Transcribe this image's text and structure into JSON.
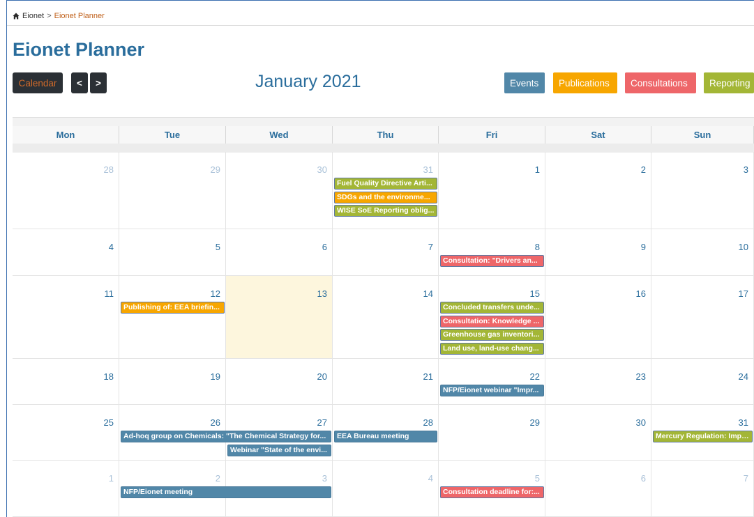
{
  "breadcrumb": {
    "home": "Eionet",
    "separator": ">",
    "current": "Eionet Planner",
    "home_icon": "home-icon"
  },
  "page": {
    "title": "Eionet Planner"
  },
  "toolbar": {
    "calendar_label": "Calendar",
    "prev_label": "<",
    "next_label": ">",
    "month_title": "January 2021"
  },
  "filters": [
    {
      "label": "Events",
      "color": "#5187a8"
    },
    {
      "label": "Publications",
      "color": "#f7a600"
    },
    {
      "label": "Consultations",
      "color": "#ee6669"
    },
    {
      "label": "Reporting",
      "color": "#a3b636"
    }
  ],
  "weekdays": [
    "Mon",
    "Tue",
    "Wed",
    "Thu",
    "Fri",
    "Sat",
    "Sun"
  ],
  "weeks": [
    [
      "28",
      "29",
      "30",
      "31",
      "1",
      "2",
      "3"
    ],
    [
      "4",
      "5",
      "6",
      "7",
      "8",
      "9",
      "10"
    ],
    [
      "11",
      "12",
      "13",
      "14",
      "15",
      "16",
      "17"
    ],
    [
      "18",
      "19",
      "20",
      "21",
      "22",
      "23",
      "24"
    ],
    [
      "25",
      "26",
      "27",
      "28",
      "29",
      "30",
      "31"
    ],
    [
      "1",
      "2",
      "3",
      "4",
      "5",
      "6",
      "7"
    ]
  ],
  "events": [
    {
      "title": "Fuel Quality Directive Arti...",
      "type": "reporting",
      "week": 0,
      "day": 3,
      "span": 1
    },
    {
      "title": "SDGs and the environme...",
      "type": "publication",
      "week": 0,
      "day": 3,
      "span": 1
    },
    {
      "title": "WISE SoE Reporting oblig...",
      "type": "reporting",
      "week": 0,
      "day": 3,
      "span": 1
    },
    {
      "title": "Consultation: \"Drivers an...",
      "type": "consultation",
      "week": 1,
      "day": 4,
      "span": 1
    },
    {
      "title": "Publishing of: EEA briefin...",
      "type": "publication",
      "week": 2,
      "day": 1,
      "span": 1
    },
    {
      "title": "Concluded transfers unde...",
      "type": "reporting",
      "week": 2,
      "day": 4,
      "span": 1
    },
    {
      "title": "Consultation: Knowledge ...",
      "type": "consultation",
      "week": 2,
      "day": 4,
      "span": 1
    },
    {
      "title": "Greenhouse gas inventori...",
      "type": "reporting",
      "week": 2,
      "day": 4,
      "span": 1
    },
    {
      "title": "Land use, land-use chang...",
      "type": "reporting",
      "week": 2,
      "day": 4,
      "span": 1
    },
    {
      "title": "NFP/Eionet webinar \"Impr...",
      "type": "event",
      "week": 3,
      "day": 4,
      "span": 1
    },
    {
      "title": "Ad-hoq group on Chemicals: \"The Chemical Strategy for...",
      "type": "event",
      "week": 4,
      "day": 1,
      "span": 2
    },
    {
      "title": "EEA Bureau meeting",
      "type": "event",
      "week": 4,
      "day": 3,
      "span": 1
    },
    {
      "title": "Mercury Regulation: Impo...",
      "type": "reporting",
      "week": 4,
      "day": 6,
      "span": 1
    },
    {
      "title": "Webinar \"State of the envi...",
      "type": "event",
      "week": 4,
      "day": 2,
      "span": 1,
      "row": 1
    },
    {
      "title": "NFP/Eionet meeting",
      "type": "event",
      "week": 5,
      "day": 1,
      "span": 2
    },
    {
      "title": "Consultation deadline for:...",
      "type": "consultation",
      "week": 5,
      "day": 4,
      "span": 1
    }
  ],
  "today": {
    "week": 2,
    "day": 2
  },
  "other_month": {
    "week0_days": [
      0,
      1,
      2,
      3
    ],
    "week5_days": [
      0,
      1,
      2,
      3,
      4,
      5,
      6
    ]
  }
}
